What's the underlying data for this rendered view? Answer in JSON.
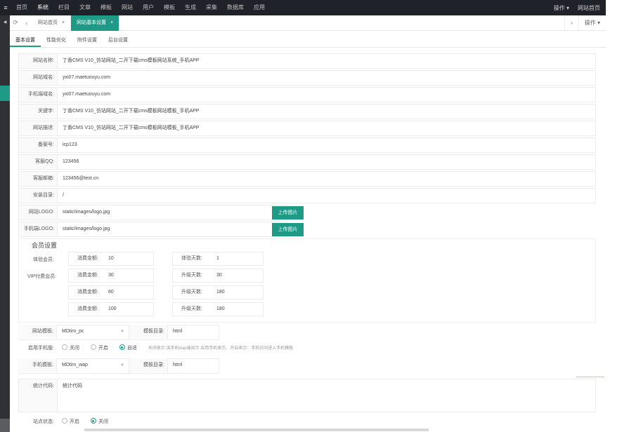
{
  "topbar": {
    "menu_icon": "menu-icon",
    "nav": [
      "首页",
      "系统",
      "栏目",
      "文章",
      "模板",
      "网站",
      "用户",
      "模板",
      "生成",
      "采集",
      "数据库",
      "应用"
    ],
    "active_index": 1,
    "right": [
      "操作 ▾",
      "网站首页"
    ]
  },
  "tabs": {
    "items": [
      {
        "label": "网站首页",
        "close": "×"
      },
      {
        "label": "网站基本设置",
        "close": "×"
      }
    ],
    "right_arrow": "›",
    "right_menu": "操作 ▾"
  },
  "subtabs": [
    "基本设置",
    "性能优化",
    "附件设置",
    "后台设置"
  ],
  "fields": [
    {
      "label": "网站名称:",
      "value": "丁香CMS V10_仿站网站_二开下载cms模板网站系统_手机APP"
    },
    {
      "label": "网站域名:",
      "value": "yxi07.maetuouyu.com"
    },
    {
      "label": "手机端域名:",
      "value": "yxi07.maetuouyu.com"
    },
    {
      "label": "关键字:",
      "value": "丁香CMS V10_仿站网站_二开下载cms模板网站模板_手机APP"
    },
    {
      "label": "网站描述:",
      "value": "丁香CMS V10_仿站网站_二开下载cms模板网站模板_手机APP"
    },
    {
      "label": "备案号:",
      "value": "icp123"
    },
    {
      "label": "客服QQ:",
      "value": "123456"
    },
    {
      "label": "客服邮箱:",
      "value": "123456@test.cn"
    },
    {
      "label": "安装目录:",
      "value": "/"
    }
  ],
  "logos": [
    {
      "label": "网站LOGO:",
      "value": "static/images/logo.jpg",
      "button": "上传图片"
    },
    {
      "label": "手机端LOGO:",
      "value": "static/images/logo.jpg",
      "button": "上传图片"
    }
  ],
  "member": {
    "title": "会员设置",
    "group1": "体验会员:",
    "group2": "VIP付费会员:",
    "rows": [
      {
        "label": "消费金额:",
        "value": "10",
        "label2": "体验天数:",
        "value2": "1"
      },
      {
        "label": "消费金额:",
        "value": "30",
        "label2": "升级天数:",
        "value2": "30"
      },
      {
        "label": "消费金额:",
        "value": "60",
        "label2": "升级天数:",
        "value2": "180"
      },
      {
        "label": "消费金额:",
        "value": "100",
        "label2": "升级天数:",
        "value2": "180"
      }
    ]
  },
  "template": {
    "pc_label": "网站模板:",
    "pc_value": "MDtim_pc",
    "pc_dir_label": "模板目录:",
    "pc_dir_value": "html",
    "mode_label": "启用手机版:",
    "modes": [
      "关闭",
      "开启",
      "自适"
    ],
    "mode_selected": 2,
    "mode_hint": "关闭表示:该手机wap端显示 启用手机表示，开启表示：手机访问进入手机模板",
    "wap_label": "手机模板:",
    "wap_value": "MDtim_wap",
    "wap_dir_label": "模板目录:",
    "wap_dir_value": "html"
  },
  "stats": {
    "label": "统计代码:",
    "value": "统计代码"
  },
  "status": {
    "label": "站点状态:",
    "options": [
      "开启",
      "关闭"
    ],
    "selected": 1
  }
}
